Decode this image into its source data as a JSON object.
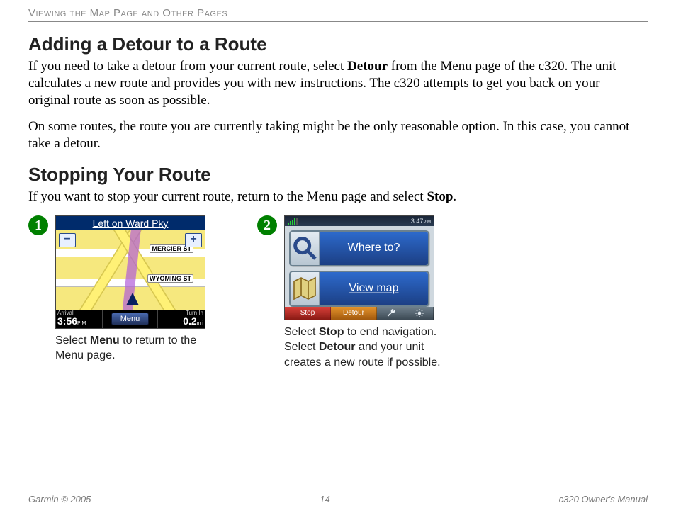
{
  "header": {
    "running_title": "Viewing the Map Page and Other Pages"
  },
  "section1": {
    "title": "Adding a Detour to a Route",
    "para1_a": "If you need to take a detour from your current route, select ",
    "para1_bold": "Detour",
    "para1_b": " from the Menu page of the c320. The unit calculates a new route and provides you with new instructions. The c320 attempts to get you back on your original route as soon as possible.",
    "para2": "On some routes, the route you are currently taking might be the only reasonable option. In this case, you cannot take a detour."
  },
  "section2": {
    "title": "Stopping Your Route",
    "para_a": "If you want to stop your current route, return to the Menu page and select ",
    "para_bold": "Stop",
    "para_b": "."
  },
  "steps": {
    "s1": {
      "num": "➊",
      "caption_a": "Select ",
      "caption_b1": "Menu",
      "caption_c": " to return to the Menu page.",
      "screen": {
        "title": "Left on Ward Pky",
        "street1": "MERCIER ST",
        "street2": "WYOMING ST",
        "zoom_out": "−",
        "zoom_in": "+",
        "arrival_label": "Arrival",
        "arrival_value": "3:56",
        "arrival_suffix": "P M",
        "menu_label": "Menu",
        "turn_label": "Turn In",
        "turn_value": "0.2",
        "turn_suffix": "m i"
      }
    },
    "s2": {
      "num": "➋",
      "caption_a": "Select ",
      "caption_b1": "Stop",
      "caption_c": " to end navigation. Select ",
      "caption_b2": "Detour",
      "caption_d": " and your unit creates a new route if possible.",
      "screen": {
        "clock": "3:47",
        "clock_suffix": "P M",
        "btn_where": "Where to?",
        "btn_view": "View map",
        "stop": "Stop",
        "detour": "Detour"
      }
    }
  },
  "footer": {
    "left": "Garmin © 2005",
    "mid": "14",
    "right": "c320 Owner's Manual"
  }
}
